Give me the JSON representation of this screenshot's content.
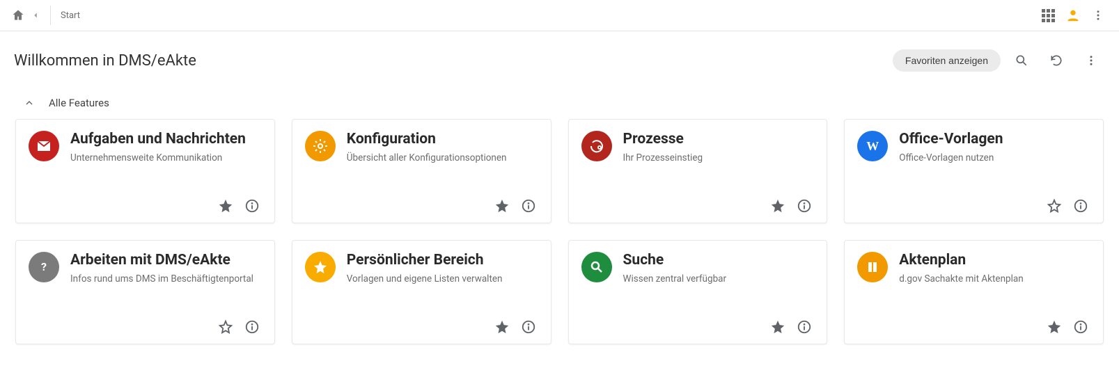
{
  "breadcrumb": "Start",
  "page_title": "Willkommen in DMS/eAkte",
  "favorites_chip": "Favoriten anzeigen",
  "section_title": "Alle Features",
  "cards": [
    {
      "title": "Aufgaben und Nachrichten",
      "subtitle": "Unternehmensweite Kommunikation",
      "starred": true
    },
    {
      "title": "Konfiguration",
      "subtitle": "Übersicht aller Konfigurationsoptionen",
      "starred": true
    },
    {
      "title": "Prozesse",
      "subtitle": "Ihr Prozesseinstieg",
      "starred": true
    },
    {
      "title": "Office-Vorlagen",
      "subtitle": "Office-Vorlagen nutzen",
      "starred": false
    },
    {
      "title": "Arbeiten mit DMS/eAkte",
      "subtitle": "Infos rund ums DMS im Beschäftigtenportal",
      "starred": false
    },
    {
      "title": "Persönlicher Bereich",
      "subtitle": "Vorlagen und eigene Listen verwalten",
      "starred": true
    },
    {
      "title": "Suche",
      "subtitle": "Wissen zentral verfügbar",
      "starred": true
    },
    {
      "title": "Aktenplan",
      "subtitle": "d.gov Sachakte mit Aktenplan",
      "starred": true
    }
  ]
}
